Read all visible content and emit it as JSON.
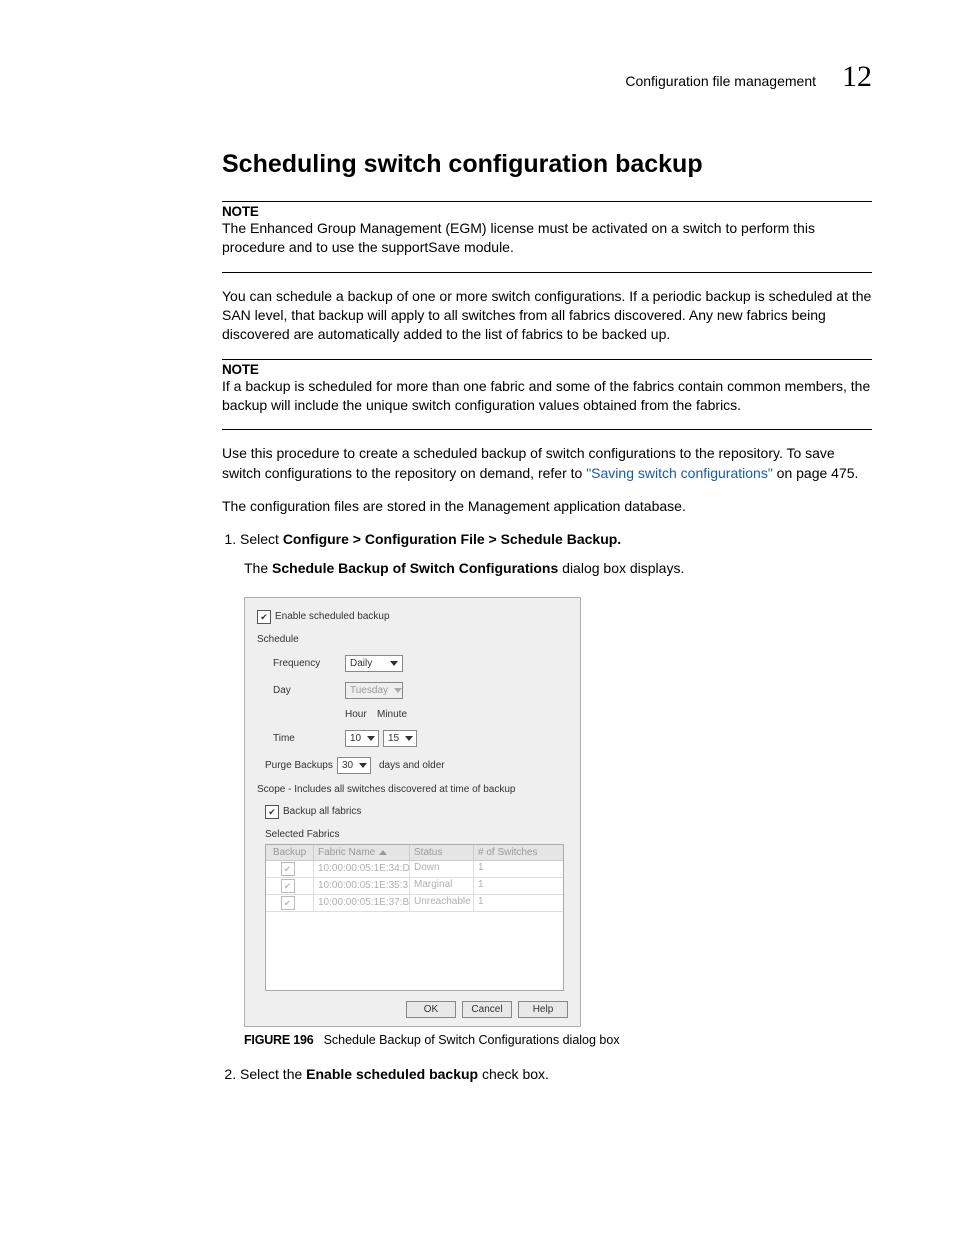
{
  "header": {
    "section_title": "Configuration file management",
    "chapter_number": "12"
  },
  "heading": "Scheduling switch configuration backup",
  "note1_label": "NOTE",
  "note1_text": "The Enhanced Group Management (EGM) license must be activated on a switch to perform this procedure and to use the supportSave module.",
  "para1": "You can schedule a backup of one or more switch configurations. If a periodic backup is scheduled at the SAN level, that backup will apply to all switches from all fabrics discovered. Any new fabrics being discovered are automatically added to the list of fabrics to be backed up.",
  "note2_label": "NOTE",
  "note2_text": "If a backup is scheduled for more than one fabric and some of the fabrics contain common members, the backup will include the unique switch configuration values obtained from the fabrics.",
  "para2_a": "Use this procedure to create a scheduled backup of switch configurations to the repository. To save switch configurations to the repository on demand, refer to ",
  "para2_link": "\"Saving switch configurations\"",
  "para2_b": " on page 475.",
  "para3": "The configuration files are stored in the Management application database.",
  "step1_prefix": "Select ",
  "step1_bold": "Configure > Configuration File > Schedule Backup.",
  "step1_sub_a": "The ",
  "step1_sub_bold": "Schedule Backup of Switch Configurations",
  "step1_sub_b": " dialog box displays.",
  "dialog": {
    "enable_label": "Enable scheduled backup",
    "schedule_label": "Schedule",
    "frequency_label": "Frequency",
    "frequency_value": "Daily",
    "day_label": "Day",
    "day_value": "Tuesday",
    "hour_label": "Hour",
    "minute_label": "Minute",
    "time_label": "Time",
    "time_hour": "10",
    "time_minute": "15",
    "purge_label": "Purge Backups",
    "purge_value": "30",
    "purge_suffix": "days and older",
    "scope_text": "Scope - Includes all switches discovered at time of backup",
    "backup_all_label": "Backup all fabrics",
    "selected_fabrics_label": "Selected Fabrics",
    "columns": {
      "c1": "Backup",
      "c2": "Fabric Name",
      "c3": "Status",
      "c4": "# of Switches"
    },
    "rows": [
      {
        "fabric": "10:00:00:05:1E:34:D...",
        "status": "Down",
        "count": "1"
      },
      {
        "fabric": "10:00:00:05:1E:35:3...",
        "status": "Marginal",
        "count": "1"
      },
      {
        "fabric": "10:00:00:05:1E:37:B...",
        "status": "Unreachable",
        "count": "1"
      }
    ],
    "btn_ok": "OK",
    "btn_cancel": "Cancel",
    "btn_help": "Help"
  },
  "figure_label": "FIGURE 196",
  "figure_caption": "Schedule Backup of Switch Configurations dialog box",
  "step2_a": "Select the ",
  "step2_bold": "Enable scheduled backup",
  "step2_b": " check box."
}
